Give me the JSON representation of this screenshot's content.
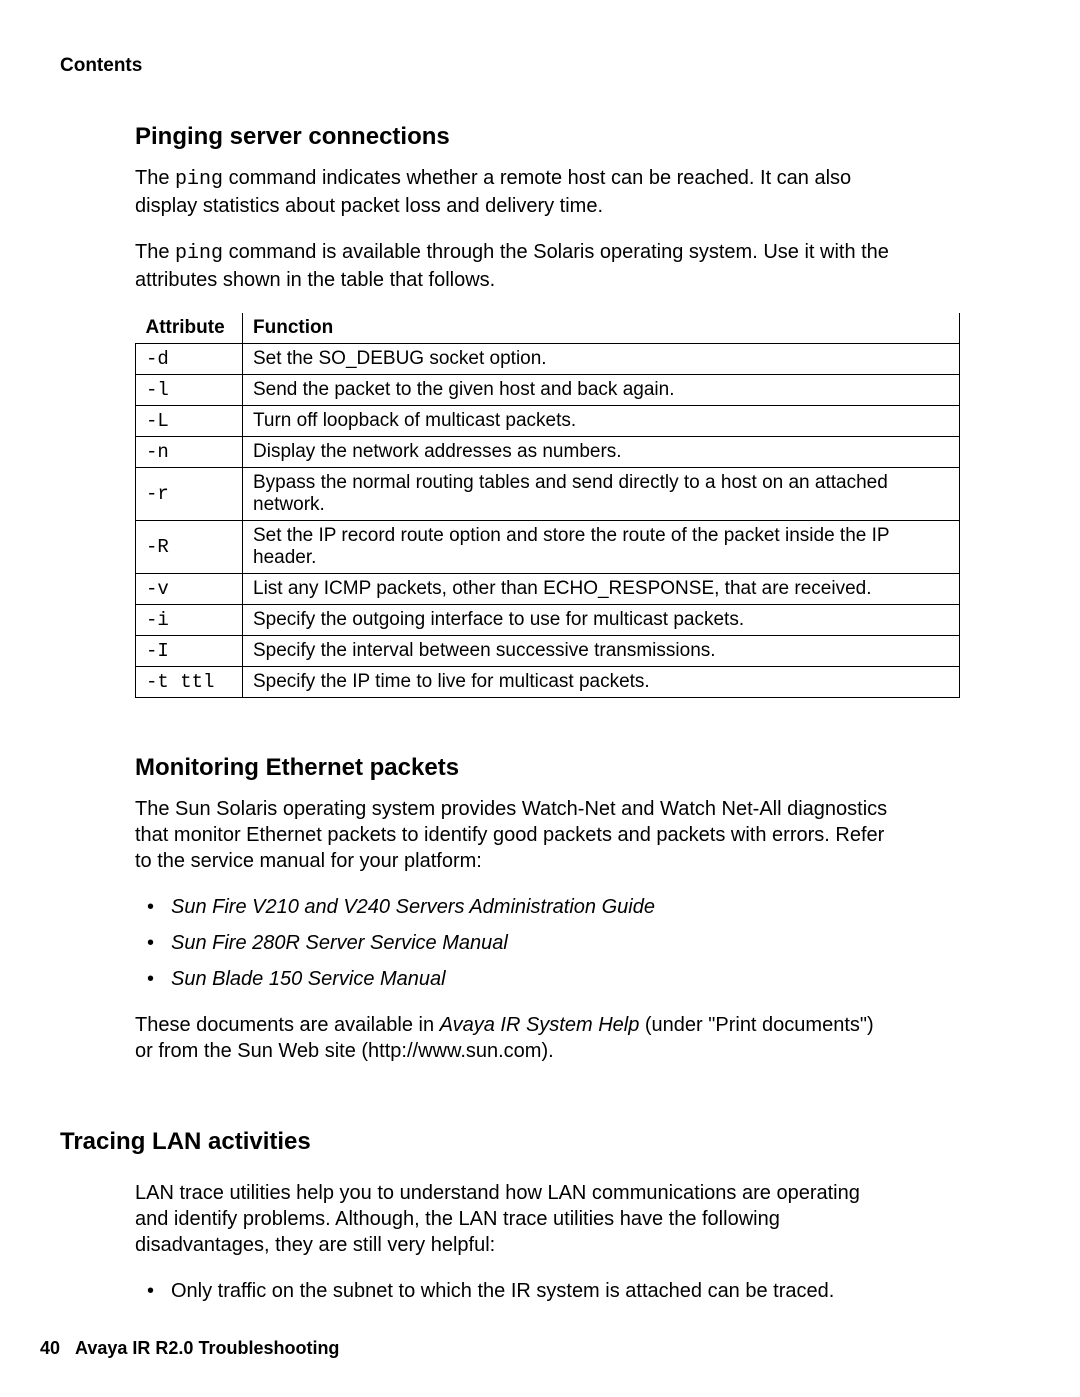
{
  "header": {
    "contents": "Contents"
  },
  "section1": {
    "title": "Pinging server connections",
    "p1_a": "The ",
    "p1_cmd": "ping",
    "p1_b": " command indicates whether a remote host can be reached. It can also display statistics about packet loss and delivery time.",
    "p2_a": "The ",
    "p2_cmd": "ping",
    "p2_b": " command is available through the Solaris operating system. Use it with the attributes shown in the table that follows."
  },
  "table": {
    "head_attr": "Attribute",
    "head_func": "Function",
    "rows": [
      {
        "attr": "-d",
        "func": "Set the SO_DEBUG socket option."
      },
      {
        "attr": "-l",
        "func": "Send the packet to the given host and back again."
      },
      {
        "attr": "-L",
        "func": "Turn off loopback of multicast packets."
      },
      {
        "attr": "-n",
        "func": "Display the network addresses as numbers."
      },
      {
        "attr": "-r",
        "func": "Bypass the normal routing tables and send directly to a host on an attached network."
      },
      {
        "attr": "-R",
        "func": "Set the IP record route option and store the route of the packet inside the IP header."
      },
      {
        "attr": "-v",
        "func": "List any ICMP packets, other than ECHO_RESPONSE, that are received."
      },
      {
        "attr": "-i",
        "func": "Specify the outgoing interface to use for multicast packets."
      },
      {
        "attr": "-I",
        "func": "Specify the interval between successive transmissions."
      },
      {
        "attr": "-t ttl",
        "func": "Specify the IP time to live for multicast packets."
      }
    ]
  },
  "section2": {
    "title": "Monitoring Ethernet packets",
    "p1": "The Sun Solaris operating system provides Watch-Net and Watch Net-All diagnostics that monitor Ethernet packets to identify good packets and packets with errors. Refer to the service manual for your platform:",
    "manuals": [
      "Sun Fire V210 and V240 Servers Administration Guide",
      "Sun Fire 280R Server Service Manual",
      "Sun Blade 150 Service Manual"
    ],
    "p2_a": "These documents are available in ",
    "p2_i": "Avaya IR System Help",
    "p2_b": " (under \"Print documents\") or from the Sun Web site (http://www.sun.com)."
  },
  "section3": {
    "title": "Tracing LAN activities",
    "p1": "LAN trace utilities help you to understand how LAN communications are operating and identify problems. Although, the LAN trace utilities have the following disadvantages, they are still very helpful:",
    "bullets": [
      "Only traffic on the subnet to which the IR system is attached can be traced."
    ]
  },
  "footer": {
    "page": "40",
    "title": "Avaya IR R2.0 Troubleshooting"
  }
}
